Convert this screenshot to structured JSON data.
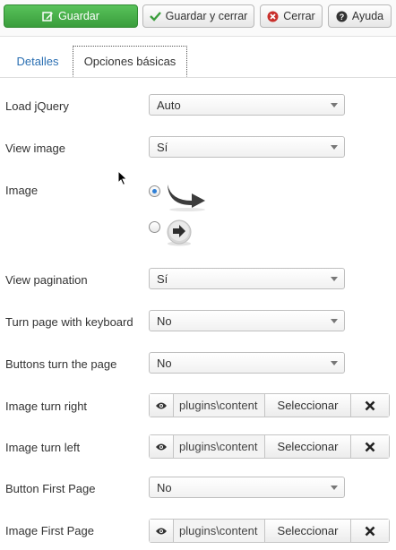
{
  "toolbar": {
    "save_label": "Guardar",
    "save_close_label": "Guardar y cerrar",
    "cancel_label": "Cerrar",
    "help_label": "Ayuda"
  },
  "tabs": [
    {
      "label": "Detalles",
      "active": false
    },
    {
      "label": "Opciones básicas",
      "active": true
    }
  ],
  "fields": {
    "load_jquery": {
      "label": "Load jQuery",
      "value": "Auto"
    },
    "view_image": {
      "label": "View image",
      "value": "Sí"
    },
    "image": {
      "label": "Image",
      "selected_option": 1
    },
    "view_pagination": {
      "label": "View pagination",
      "value": "Sí"
    },
    "turn_page_keyboard": {
      "label": "Turn page with keyboard",
      "value": "No"
    },
    "buttons_turn_page": {
      "label": "Buttons turn the page",
      "value": "No"
    },
    "image_turn_right": {
      "label": "Image turn right",
      "path": "plugins\\content",
      "select_label": "Seleccionar"
    },
    "image_turn_left": {
      "label": "Image turn left",
      "path": "plugins\\content",
      "select_label": "Seleccionar"
    },
    "button_first_page": {
      "label": "Button First Page",
      "value": "No"
    },
    "image_first_page": {
      "label": "Image First Page",
      "path": "plugins\\content",
      "select_label": "Seleccionar"
    }
  },
  "colors": {
    "save_button": "#45a847",
    "active_link": "#2a6fb2",
    "radio_selected": "#2f7fd6"
  }
}
